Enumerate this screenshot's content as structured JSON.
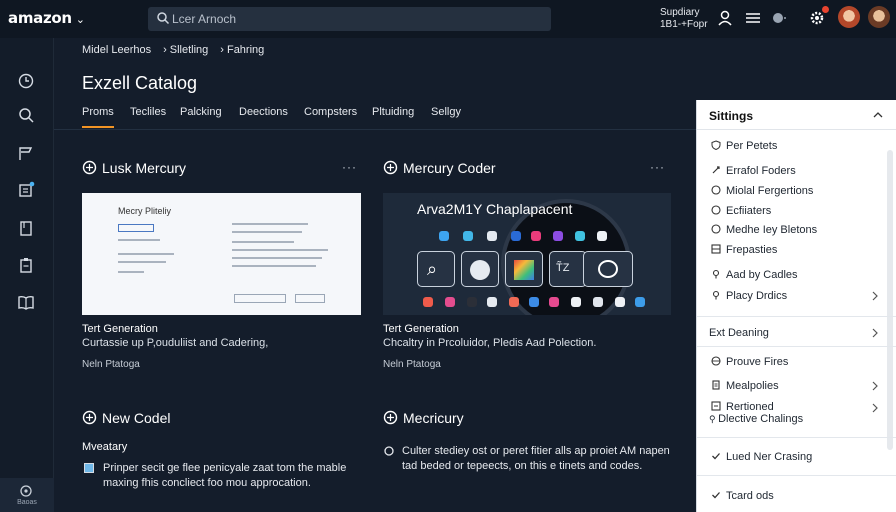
{
  "topbar": {
    "logo": "amazon",
    "search_placeholder": "Lcer Arnoch",
    "account_line1": "Supdiary",
    "account_line2": "1B1-+Fopr"
  },
  "rail": {
    "bottom_label": "Baoas"
  },
  "breadcrumb": [
    "Midel Leerhos",
    "Slletling",
    "Fahring"
  ],
  "page_title": "Exzell Catalog",
  "tabs": [
    "Proms",
    "Tecliles",
    "Palcking",
    "Deections",
    "Compsters",
    "Pltuiding",
    "Sellgy"
  ],
  "cards": [
    {
      "title": "Lusk Mercury",
      "more": "···",
      "thumb_title": "Mecry Pliteliy",
      "subtitle": "Tert Generation",
      "description": "Curtassie up P,ouduliist and Cadering,",
      "meta": "Neln Ptatoga"
    },
    {
      "title": "Mercury Coder",
      "more": "···",
      "thumb_title": "Arva2M1Y Chaplapacent",
      "subtitle": "Tert Generation",
      "description": "Chcaltry in Prcoluidor, Pledis Aad Polection.",
      "meta": "Neln Ptatoga"
    },
    {
      "title": "New Codel",
      "heading": "Mveatary",
      "text": "Prinper secit ge flee penicyale zaat tom the mable maxing fhis concliect foo mou approcation."
    },
    {
      "title": "Mecricury",
      "text": "Culter stediey ost or peret fitier alls ap proiet AM napen tad beded or tepeects, on this e tinets and codes."
    }
  ],
  "settings": {
    "title": "Sittings",
    "items": [
      {
        "label": "Per Petets",
        "icon": "shield-icon",
        "chevron": false
      },
      {
        "label": "Errafol Foders",
        "icon": "link-icon",
        "chevron": false
      },
      {
        "label": "Miolal Fergertions",
        "icon": "circle-icon",
        "chevron": false
      },
      {
        "label": "Ecfiiaters",
        "icon": "circle-icon",
        "chevron": false
      },
      {
        "label": "Medhe Iey Bletons",
        "icon": "circle-icon",
        "chevron": false
      },
      {
        "label": "Frepasties",
        "icon": "grid-icon",
        "chevron": false
      },
      {
        "label": "Aad by Cadles",
        "icon": "pin-icon",
        "chevron": false
      },
      {
        "label": "Placy Drdics",
        "icon": "pin-icon",
        "chevron": true
      },
      {
        "label": "Ext Deaning",
        "icon": "",
        "chevron": true
      },
      {
        "label": "Prouve Fires",
        "icon": "globe-icon",
        "chevron": false
      },
      {
        "label": "Mealpolies",
        "icon": "doc-icon",
        "chevron": true
      },
      {
        "label": "Rertioned",
        "label2": "Dlective Chalings",
        "icon": "box-icon",
        "chevron": true
      },
      {
        "label": "Lued Ner Crasing",
        "icon": "check-icon",
        "chevron": false
      },
      {
        "label": "Tcard ods",
        "icon": "check-icon",
        "chevron": false
      }
    ]
  },
  "colors": {
    "accent": "#f29425",
    "background": "#141d2b",
    "topbar": "#0f1722"
  }
}
